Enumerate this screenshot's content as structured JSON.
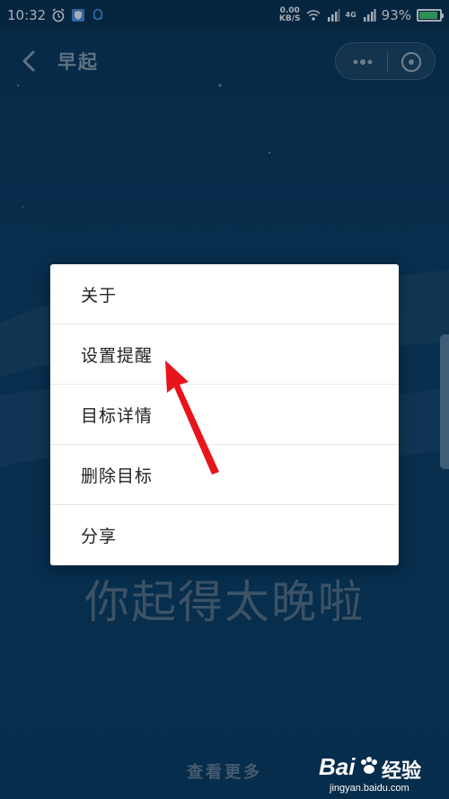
{
  "status_bar": {
    "time": "10:32",
    "net_speed_value": "0.00",
    "net_speed_unit": "KB/S",
    "network_type": "4G",
    "battery_text": "93%",
    "battery_level": 0.93
  },
  "header": {
    "title": "早起"
  },
  "menu": {
    "items": [
      {
        "label": "关于"
      },
      {
        "label": "设置提醒"
      },
      {
        "label": "目标详情"
      },
      {
        "label": "删除目标"
      },
      {
        "label": "分享"
      }
    ]
  },
  "main": {
    "headline": "你起得太晚啦",
    "view_more": "查看更多"
  },
  "watermark": {
    "logo": "Bai",
    "logo_suffix": "经验",
    "url": "jingyan.baidu.com"
  },
  "colors": {
    "background": "#0c3a5e",
    "arrow": "#e8141b",
    "battery_fill": "#49d36a"
  },
  "icons": [
    "alarm-icon",
    "shield-icon",
    "qq-icon",
    "wifi-icon",
    "signal-icon",
    "battery-icon",
    "back-icon",
    "more-icon",
    "close-icon",
    "red-arrow",
    "paw-icon"
  ]
}
